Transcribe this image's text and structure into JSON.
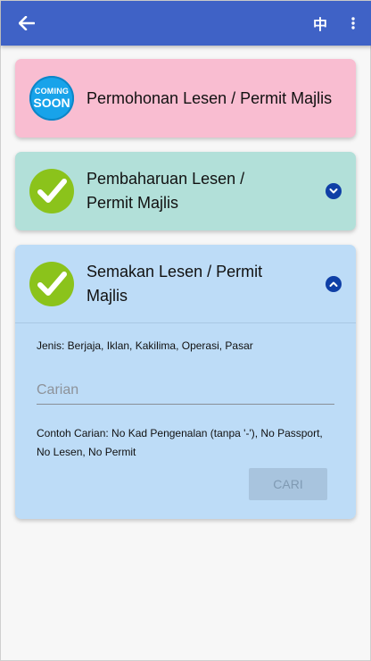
{
  "topbar": {
    "back_icon": "arrow-left-icon",
    "lang_label": "中",
    "menu_icon": "more-vert-icon",
    "bg_color": "#3f62c6"
  },
  "cards": [
    {
      "title": "Permohonan Lesen / Permit Majlis",
      "badge": {
        "line1": "COMING",
        "line2": "SOON"
      },
      "color": "#f9bdd1"
    },
    {
      "title_line1": "Pembaharuan Lesen /",
      "title_line2": "Permit Majlis",
      "icon": "checkmark-icon",
      "toggle_icon": "chevron-down-icon",
      "color": "#b2e0d9"
    },
    {
      "title_line1": "Semakan Lesen / Permit",
      "title_line2": "Majlis",
      "icon": "checkmark-icon",
      "toggle_icon": "chevron-up-icon",
      "color": "#bddcf7",
      "jenis": "Jenis: Berjaja, Iklan, Kakilima, Operasi, Pasar",
      "search_placeholder": "Carian",
      "search_value": "",
      "hint_line1": "Contoh Carian: No Kad Pengenalan (tanpa '-'), No Passport,",
      "hint_line2": "No Lesen, No Permit",
      "button_label": "CARI"
    }
  ]
}
